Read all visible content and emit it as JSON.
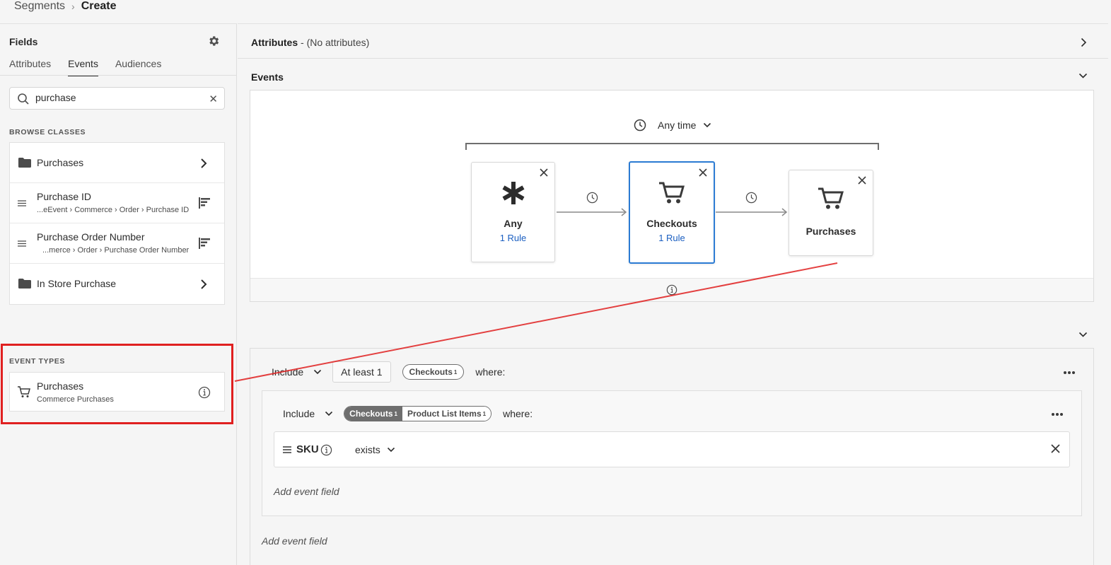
{
  "breadcrumb": {
    "root": "Segments",
    "separator": "›",
    "current": "Create"
  },
  "fields_panel": {
    "title": "Fields",
    "tabs": [
      {
        "label": "Attributes"
      },
      {
        "label": "Events"
      },
      {
        "label": "Audiences"
      }
    ],
    "active_tab": "Events",
    "search": {
      "value": "purchase",
      "placeholder": "Search"
    },
    "browse_classes_label": "BROWSE CLASSES",
    "classes": [
      {
        "type": "folder",
        "title": "Purchases"
      },
      {
        "type": "field",
        "title": "Purchase ID",
        "path": "...eEvent › Commerce › Order › Purchase ID"
      },
      {
        "type": "field",
        "title": "Purchase Order Number",
        "path": "...merce › Order › Purchase Order Number"
      },
      {
        "type": "folder",
        "title": "In Store Purchase"
      }
    ],
    "event_types_label": "EVENT TYPES",
    "event_types": [
      {
        "title": "Purchases",
        "subtitle": "Commerce Purchases"
      }
    ]
  },
  "attributes_bar": {
    "title": "Attributes",
    "detail": " - (No attributes)"
  },
  "events_section": {
    "title": "Events",
    "time_constraint": "Any time",
    "nodes": [
      {
        "title": "Any",
        "rule": "1 Rule",
        "icon": "asterisk-icon"
      },
      {
        "title": "Checkouts",
        "rule": "1 Rule",
        "icon": "cart-icon"
      },
      {
        "title": "Purchases",
        "rule": "",
        "icon": "cart-icon"
      }
    ]
  },
  "rule_builder": {
    "outer": {
      "include_label": "Include",
      "count_value": "At least 1",
      "event_tag": "Checkouts",
      "event_tag_sup": "1",
      "where_label": "where:"
    },
    "inner": {
      "include_label": "Include",
      "tags": [
        {
          "label": "Checkouts",
          "sup": "1"
        },
        {
          "label": "Product List Items",
          "sup": "1"
        }
      ],
      "where_label": "where:",
      "condition": {
        "field": "SKU",
        "operator": "exists"
      },
      "add_event_field": "Add event field"
    },
    "add_event_field": "Add event field"
  },
  "colors": {
    "accent": "#2b7bd3",
    "link": "#1b5fc1",
    "annotation": "#e02020"
  }
}
